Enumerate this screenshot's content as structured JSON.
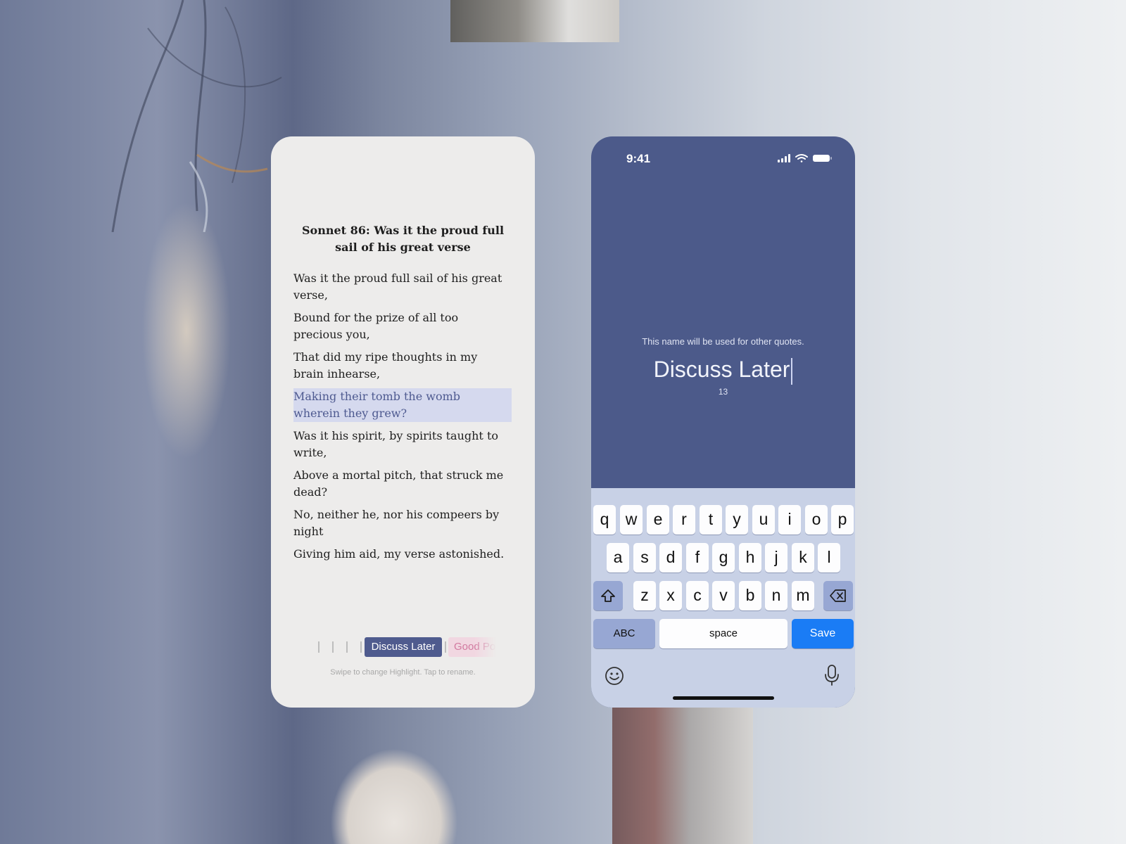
{
  "reader": {
    "title": "Sonnet 86: Was it the proud full sail of his great verse",
    "lines": [
      {
        "text": "Was it the proud full sail of his great verse,",
        "highlighted": false
      },
      {
        "text": "Bound for the prize of all too precious you,",
        "highlighted": false
      },
      {
        "text": "That did my ripe thoughts in my brain inhearse,",
        "highlighted": false
      },
      {
        "text": "Making their tomb the womb wherein they grew?",
        "highlighted": true
      },
      {
        "text": "Was it his spirit, by spirits taught to write,",
        "highlighted": false
      },
      {
        "text": "Above a mortal pitch, that struck me dead?",
        "highlighted": false
      },
      {
        "text": "No, neither he, nor his compeers by night",
        "highlighted": false
      },
      {
        "text": "Giving him aid, my verse astonished.",
        "highlighted": false
      }
    ],
    "highlight_chips": {
      "active": "Discuss Later",
      "next": "Good Po"
    },
    "hint": "Swipe to change Highlight. Tap to rename.",
    "highlight_color": "#d5d9ee",
    "active_chip_color": "#4f5b8e"
  },
  "rename": {
    "status_time": "9:41",
    "helper_text": "This name will be used for other quotes.",
    "name_value": "Discuss Later",
    "char_count": "13",
    "background_color": "#4c5a8a"
  },
  "keyboard": {
    "row1": [
      "q",
      "w",
      "e",
      "r",
      "t",
      "y",
      "u",
      "i",
      "o",
      "p"
    ],
    "row2": [
      "a",
      "s",
      "d",
      "f",
      "g",
      "h",
      "j",
      "k",
      "l"
    ],
    "row3": [
      "z",
      "x",
      "c",
      "v",
      "b",
      "n",
      "m"
    ],
    "shift_icon": "shift-icon",
    "delete_icon": "delete-icon",
    "abc_label": "ABC",
    "space_label": "space",
    "save_label": "Save",
    "emoji_icon": "emoji-icon",
    "mic_icon": "microphone-icon",
    "save_color": "#1a7cf5"
  }
}
